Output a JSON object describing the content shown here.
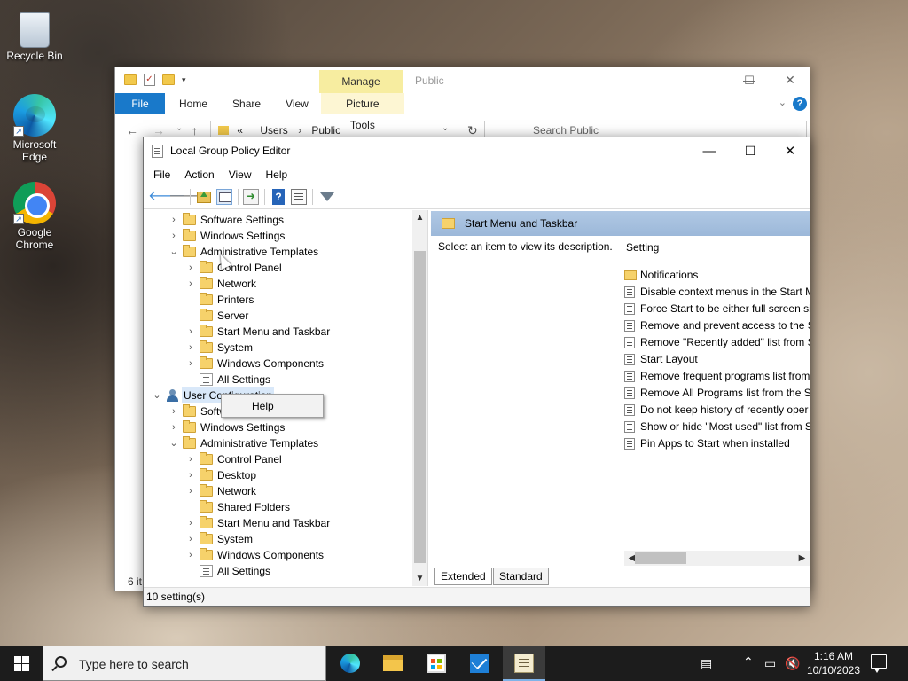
{
  "desktop": {
    "icons": [
      {
        "label": "Recycle Bin",
        "icon": "recycle-bin-icon"
      },
      {
        "label": "Microsoft Edge",
        "label_line1": "Microsoft",
        "label_line2": "Edge",
        "icon": "edge-icon"
      },
      {
        "label": "Google Chrome",
        "label_line1": "Google",
        "label_line2": "Chrome",
        "icon": "chrome-icon"
      }
    ]
  },
  "explorer": {
    "manage_tab": "Manage",
    "title": "Public",
    "ribbon": {
      "file": "File",
      "home": "Home",
      "share": "Share",
      "view": "View",
      "picture_tools": "Picture Tools"
    },
    "address": {
      "crumb1": "Users",
      "crumb2": "Public",
      "sep": "«"
    },
    "search_placeholder": "Search Public",
    "status": "6 it"
  },
  "gpe": {
    "title": "Local Group Policy Editor",
    "menu": [
      "File",
      "Action",
      "View",
      "Help"
    ],
    "toolbar": [
      "back-icon",
      "forward-icon",
      "up-folder-icon",
      "show-hide-tree-icon",
      "export-list-icon",
      "help-icon",
      "properties-icon",
      "filter-icon"
    ],
    "tree": [
      {
        "label": "Software Settings",
        "indent": 1,
        "expander": ">",
        "icon": "folder"
      },
      {
        "label": "Windows Settings",
        "indent": 1,
        "expander": ">",
        "icon": "folder"
      },
      {
        "label": "Administrative Templates",
        "indent": 1,
        "expander": "v",
        "icon": "folder"
      },
      {
        "label": "Control Panel",
        "indent": 2,
        "expander": ">",
        "icon": "folder"
      },
      {
        "label": "Network",
        "indent": 2,
        "expander": ">",
        "icon": "folder"
      },
      {
        "label": "Printers",
        "indent": 2,
        "expander": "",
        "icon": "folder"
      },
      {
        "label": "Server",
        "indent": 2,
        "expander": "",
        "icon": "folder"
      },
      {
        "label": "Start Menu and Taskbar",
        "indent": 2,
        "expander": ">",
        "icon": "folder"
      },
      {
        "label": "System",
        "indent": 2,
        "expander": ">",
        "icon": "folder"
      },
      {
        "label": "Windows Components",
        "indent": 2,
        "expander": ">",
        "icon": "folder"
      },
      {
        "label": "All Settings",
        "indent": 2,
        "expander": "",
        "icon": "all"
      },
      {
        "label": "User Configuration",
        "indent": 0,
        "expander": "v",
        "icon": "user",
        "selected": true
      },
      {
        "label": "Software Settings",
        "indent": 1,
        "expander": ">",
        "icon": "folder"
      },
      {
        "label": "Windows Settings",
        "indent": 1,
        "expander": ">",
        "icon": "folder"
      },
      {
        "label": "Administrative Templates",
        "indent": 1,
        "expander": "v",
        "icon": "folder"
      },
      {
        "label": "Control Panel",
        "indent": 2,
        "expander": ">",
        "icon": "folder"
      },
      {
        "label": "Desktop",
        "indent": 2,
        "expander": ">",
        "icon": "folder"
      },
      {
        "label": "Network",
        "indent": 2,
        "expander": ">",
        "icon": "folder"
      },
      {
        "label": "Shared Folders",
        "indent": 2,
        "expander": "",
        "icon": "folder"
      },
      {
        "label": "Start Menu and Taskbar",
        "indent": 2,
        "expander": ">",
        "icon": "folder"
      },
      {
        "label": "System",
        "indent": 2,
        "expander": ">",
        "icon": "folder"
      },
      {
        "label": "Windows Components",
        "indent": 2,
        "expander": ">",
        "icon": "folder"
      },
      {
        "label": "All Settings",
        "indent": 2,
        "expander": "",
        "icon": "all"
      }
    ],
    "right_pane": {
      "header": "Start Menu and Taskbar",
      "description": "Select an item to view its description.",
      "column": "Setting",
      "items": [
        {
          "label": "Notifications",
          "type": "folder"
        },
        {
          "label": "Disable context menus in the Start M",
          "type": "policy"
        },
        {
          "label": "Force Start to be either full screen siz",
          "type": "policy"
        },
        {
          "label": "Remove and prevent access to the S",
          "type": "policy"
        },
        {
          "label": "Remove \"Recently added\" list from S",
          "type": "policy"
        },
        {
          "label": "Start Layout",
          "type": "policy"
        },
        {
          "label": "Remove frequent programs list from",
          "type": "policy"
        },
        {
          "label": "Remove All Programs list from the S",
          "type": "policy"
        },
        {
          "label": "Do not keep history of recently oper",
          "type": "policy"
        },
        {
          "label": "Show or hide \"Most used\" list from S",
          "type": "policy"
        },
        {
          "label": "Pin Apps to Start when installed",
          "type": "policy"
        }
      ],
      "tabs": [
        "Extended",
        "Standard"
      ],
      "active_tab": "Extended"
    },
    "status": "10 setting(s)",
    "context_menu": [
      "Help"
    ]
  },
  "taskbar": {
    "search_placeholder": "Type here to search",
    "apps": [
      "edge-icon",
      "file-explorer-icon",
      "store-icon",
      "mail-icon",
      "group-policy-editor-icon"
    ],
    "active_app": "group-policy-editor-icon",
    "time": "1:16 AM",
    "date": "10/10/2023"
  }
}
